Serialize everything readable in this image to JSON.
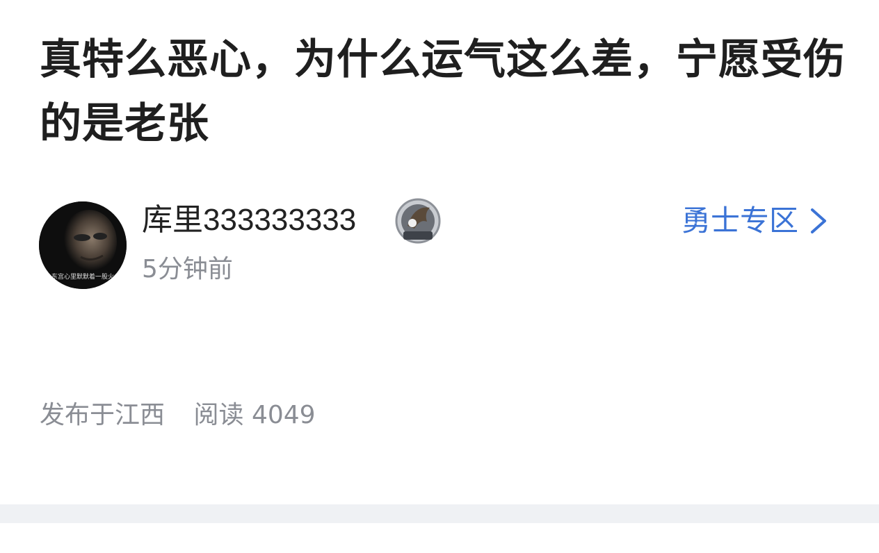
{
  "post": {
    "title": "真特么恶心，为什么运气这么差，宁愿受伤的是老张"
  },
  "author": {
    "username": "库里333333333",
    "time": "5分钟前",
    "avatar_icon": "profile-photo",
    "avatar_caption": "东宫心里默默着一股火",
    "badge_icon": "level-badge"
  },
  "forum": {
    "label": "勇士专区",
    "icon": "chevron-right-icon",
    "color": "#3b73d6"
  },
  "meta": {
    "location": "发布于江西",
    "reads_label": "阅读",
    "reads_count": "4049"
  },
  "colors": {
    "title": "#1f1f1f",
    "secondary_text": "#8a8d94",
    "divider": "#eff1f4"
  }
}
